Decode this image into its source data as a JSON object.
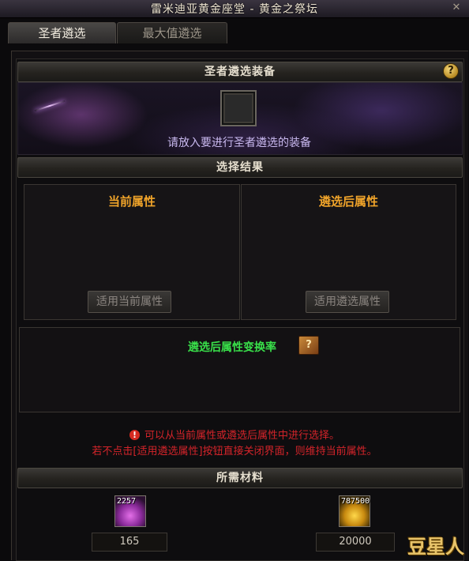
{
  "window": {
    "title": "雷米迪亚黄金座堂 - 黄金之祭坛",
    "close_icon": "close-icon"
  },
  "tabs": [
    {
      "label": "圣者遴选",
      "active": true
    },
    {
      "label": "最大值遴选",
      "active": false
    }
  ],
  "equip_section": {
    "title": "圣者遴选装备",
    "help_icon": "question-mark-icon",
    "help_label": "?",
    "slot_hint": "请放入要进行圣者遴选的装备"
  },
  "result_section": {
    "title": "选择结果",
    "current": {
      "title": "当前属性",
      "button": "适用当前属性"
    },
    "after": {
      "title": "遴选后属性",
      "button": "适用遴选属性"
    }
  },
  "rate_section": {
    "title": "遴选后属性变换率",
    "icon": "book-icon",
    "icon_label": "?"
  },
  "warnings": {
    "icon": "!",
    "line1": "可以从当前属性或遴选后属性中进行选择。",
    "line2": "若不点击[适用遴选属性]按钮直接关闭界面，则维持当前属性。"
  },
  "materials_section": {
    "title": "所需材料",
    "items": [
      {
        "icon": "purple-gem-icon",
        "owned": "2257",
        "required": "165"
      },
      {
        "icon": "gold-coin-icon",
        "owned": "787500",
        "required": "20000"
      }
    ]
  },
  "watermark": "豆星人",
  "colors": {
    "attr_title": "#f0a42a",
    "rate_title": "#39e04a",
    "warning": "#d4242a",
    "slot_hint": "#c9b9ef"
  }
}
